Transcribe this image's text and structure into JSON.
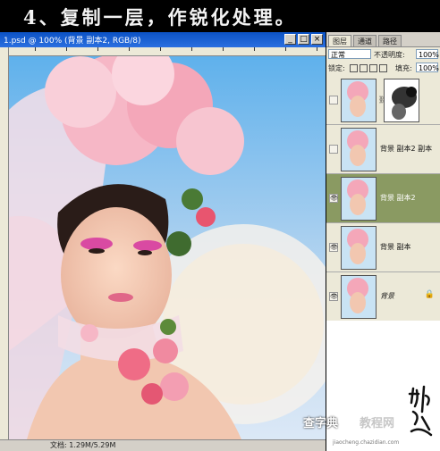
{
  "caption": {
    "text": "4、复制一层，作锐化处理。"
  },
  "document": {
    "title": "1.psd @ 100% (背景 副本2, RGB/8)",
    "buttons": {
      "minimize": "_",
      "maximize": "□",
      "close": "×"
    },
    "status": "文档: 1.29M/5.29M",
    "colors": {
      "titlebar": "#0b52c4",
      "sky": "#bcd7f0",
      "skin": "#f2c7b0",
      "flowers": "#f4a7b9"
    }
  },
  "layers_panel": {
    "tabs": [
      {
        "label": "图层",
        "active": true
      },
      {
        "label": "通道",
        "active": false
      },
      {
        "label": "路径",
        "active": false
      }
    ],
    "blend_mode": "正常",
    "opacity_label": "不透明度:",
    "opacity_value": "100%",
    "lock_label": "锁定:",
    "fill_label": "填充:",
    "fill_value": "100%",
    "layers": [
      {
        "name": "",
        "visible": false,
        "has_mask": true,
        "selected": false
      },
      {
        "name": "背景 副本2 副本",
        "visible": false,
        "has_mask": false,
        "selected": false
      },
      {
        "name": "背景 副本2",
        "visible": true,
        "has_mask": false,
        "selected": true
      },
      {
        "name": "背景 副本",
        "visible": true,
        "has_mask": false,
        "selected": false
      },
      {
        "name": "背景",
        "visible": true,
        "has_mask": false,
        "selected": false,
        "locked": true
      }
    ],
    "selected_color": "#8a9a62"
  },
  "watermark": {
    "site_a": "查字典",
    "site_b": "教程网",
    "url": "jiaocheng.chazidian.com"
  }
}
